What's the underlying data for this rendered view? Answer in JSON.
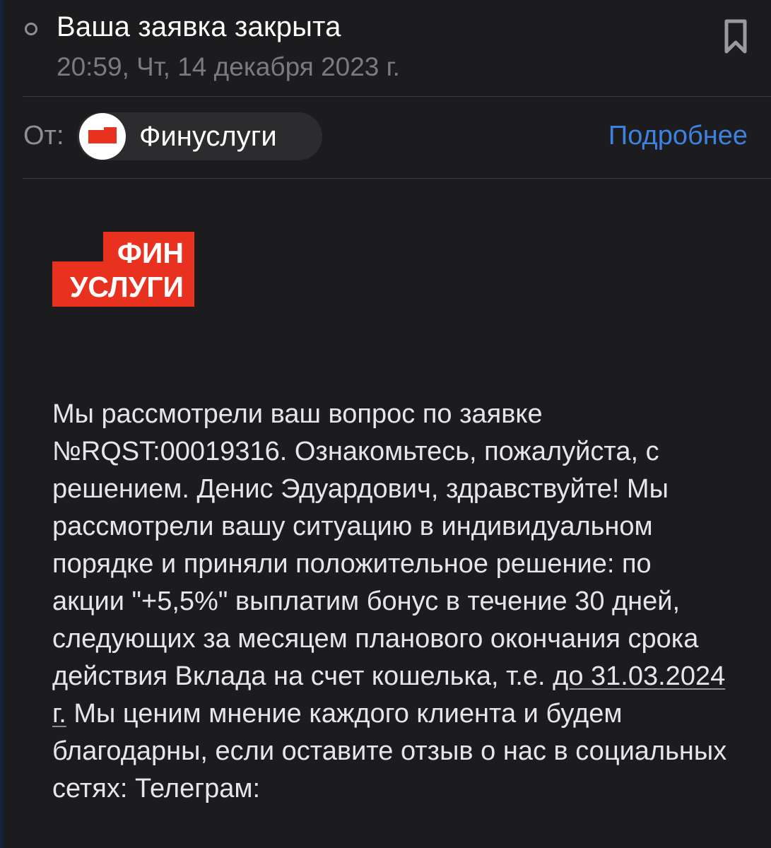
{
  "message": {
    "subject": "Ваша заявка закрыта",
    "date": "20:59, Чт, 14 декабря 2023 г.",
    "from_label": "От:",
    "sender_name": "Финуслуги",
    "details_link": "Подробнее"
  },
  "logo": {
    "line1": "ФИН",
    "line2": "УСЛУГИ",
    "brand_color": "#e8321f"
  },
  "body": {
    "text_before": "Мы рассмотрели ваш вопрос по заявке №RQST:00019316. Ознакомьтесь, пожалуйста, с решением. Денис Эдуардович, здравствуйте! Мы рассмотрели вашу ситуацию в индивидуальном порядке и приняли положительное решение: по акции \"+5,5%\" выплатим бонус в течение 30 дней, следующих за месяцем планового окончания срока действия Вклада на счет кошелька, т.е. ",
    "date_link": "до 31.03.2024 г.",
    "text_after": " Мы ценим мнение каждого клиента и будем благодарны, если оставите отзыв о нас в социальных сетях: Телеграм:"
  },
  "icons": {
    "unread": "unread-dot-icon",
    "bookmark": "bookmark-icon",
    "avatar": "finuslugi-logo-icon"
  },
  "colors": {
    "background": "#1c1c1e",
    "link": "#3d82e0",
    "secondary_text": "#8e8e93"
  }
}
